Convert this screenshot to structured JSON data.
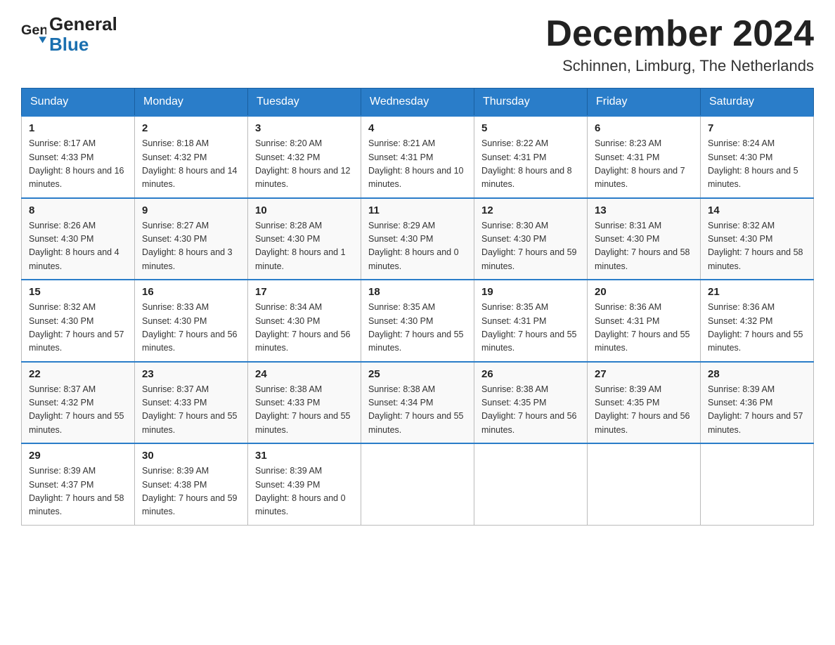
{
  "header": {
    "logo_text_general": "General",
    "logo_text_blue": "Blue",
    "month_year": "December 2024",
    "location": "Schinnen, Limburg, The Netherlands"
  },
  "days_of_week": [
    "Sunday",
    "Monday",
    "Tuesday",
    "Wednesday",
    "Thursday",
    "Friday",
    "Saturday"
  ],
  "weeks": [
    [
      {
        "day": "1",
        "sunrise": "8:17 AM",
        "sunset": "4:33 PM",
        "daylight": "8 hours and 16 minutes."
      },
      {
        "day": "2",
        "sunrise": "8:18 AM",
        "sunset": "4:32 PM",
        "daylight": "8 hours and 14 minutes."
      },
      {
        "day": "3",
        "sunrise": "8:20 AM",
        "sunset": "4:32 PM",
        "daylight": "8 hours and 12 minutes."
      },
      {
        "day": "4",
        "sunrise": "8:21 AM",
        "sunset": "4:31 PM",
        "daylight": "8 hours and 10 minutes."
      },
      {
        "day": "5",
        "sunrise": "8:22 AM",
        "sunset": "4:31 PM",
        "daylight": "8 hours and 8 minutes."
      },
      {
        "day": "6",
        "sunrise": "8:23 AM",
        "sunset": "4:31 PM",
        "daylight": "8 hours and 7 minutes."
      },
      {
        "day": "7",
        "sunrise": "8:24 AM",
        "sunset": "4:30 PM",
        "daylight": "8 hours and 5 minutes."
      }
    ],
    [
      {
        "day": "8",
        "sunrise": "8:26 AM",
        "sunset": "4:30 PM",
        "daylight": "8 hours and 4 minutes."
      },
      {
        "day": "9",
        "sunrise": "8:27 AM",
        "sunset": "4:30 PM",
        "daylight": "8 hours and 3 minutes."
      },
      {
        "day": "10",
        "sunrise": "8:28 AM",
        "sunset": "4:30 PM",
        "daylight": "8 hours and 1 minute."
      },
      {
        "day": "11",
        "sunrise": "8:29 AM",
        "sunset": "4:30 PM",
        "daylight": "8 hours and 0 minutes."
      },
      {
        "day": "12",
        "sunrise": "8:30 AM",
        "sunset": "4:30 PM",
        "daylight": "7 hours and 59 minutes."
      },
      {
        "day": "13",
        "sunrise": "8:31 AM",
        "sunset": "4:30 PM",
        "daylight": "7 hours and 58 minutes."
      },
      {
        "day": "14",
        "sunrise": "8:32 AM",
        "sunset": "4:30 PM",
        "daylight": "7 hours and 58 minutes."
      }
    ],
    [
      {
        "day": "15",
        "sunrise": "8:32 AM",
        "sunset": "4:30 PM",
        "daylight": "7 hours and 57 minutes."
      },
      {
        "day": "16",
        "sunrise": "8:33 AM",
        "sunset": "4:30 PM",
        "daylight": "7 hours and 56 minutes."
      },
      {
        "day": "17",
        "sunrise": "8:34 AM",
        "sunset": "4:30 PM",
        "daylight": "7 hours and 56 minutes."
      },
      {
        "day": "18",
        "sunrise": "8:35 AM",
        "sunset": "4:30 PM",
        "daylight": "7 hours and 55 minutes."
      },
      {
        "day": "19",
        "sunrise": "8:35 AM",
        "sunset": "4:31 PM",
        "daylight": "7 hours and 55 minutes."
      },
      {
        "day": "20",
        "sunrise": "8:36 AM",
        "sunset": "4:31 PM",
        "daylight": "7 hours and 55 minutes."
      },
      {
        "day": "21",
        "sunrise": "8:36 AM",
        "sunset": "4:32 PM",
        "daylight": "7 hours and 55 minutes."
      }
    ],
    [
      {
        "day": "22",
        "sunrise": "8:37 AM",
        "sunset": "4:32 PM",
        "daylight": "7 hours and 55 minutes."
      },
      {
        "day": "23",
        "sunrise": "8:37 AM",
        "sunset": "4:33 PM",
        "daylight": "7 hours and 55 minutes."
      },
      {
        "day": "24",
        "sunrise": "8:38 AM",
        "sunset": "4:33 PM",
        "daylight": "7 hours and 55 minutes."
      },
      {
        "day": "25",
        "sunrise": "8:38 AM",
        "sunset": "4:34 PM",
        "daylight": "7 hours and 55 minutes."
      },
      {
        "day": "26",
        "sunrise": "8:38 AM",
        "sunset": "4:35 PM",
        "daylight": "7 hours and 56 minutes."
      },
      {
        "day": "27",
        "sunrise": "8:39 AM",
        "sunset": "4:35 PM",
        "daylight": "7 hours and 56 minutes."
      },
      {
        "day": "28",
        "sunrise": "8:39 AM",
        "sunset": "4:36 PM",
        "daylight": "7 hours and 57 minutes."
      }
    ],
    [
      {
        "day": "29",
        "sunrise": "8:39 AM",
        "sunset": "4:37 PM",
        "daylight": "7 hours and 58 minutes."
      },
      {
        "day": "30",
        "sunrise": "8:39 AM",
        "sunset": "4:38 PM",
        "daylight": "7 hours and 59 minutes."
      },
      {
        "day": "31",
        "sunrise": "8:39 AM",
        "sunset": "4:39 PM",
        "daylight": "8 hours and 0 minutes."
      },
      null,
      null,
      null,
      null
    ]
  ],
  "labels": {
    "sunrise": "Sunrise:",
    "sunset": "Sunset:",
    "daylight": "Daylight:"
  }
}
